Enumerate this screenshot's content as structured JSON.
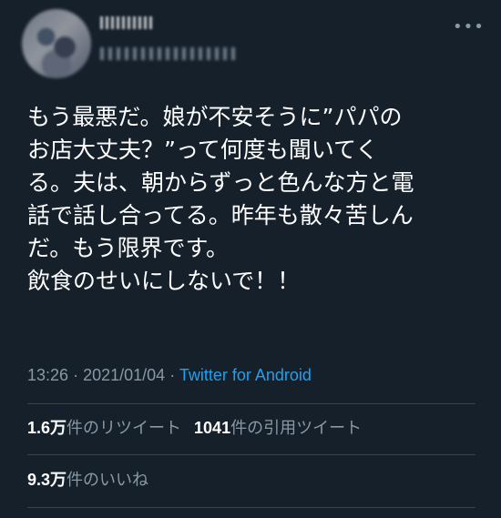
{
  "tweet": {
    "more_icon": "more-horizontal-icon",
    "body": "もう最悪だ。娘が不安そうに”パパの\nお店大丈夫？”って何度も聞いてく\nる。夫は、朝からずっと色んな方と電\n話で話し合ってる。昨年も散々苦しん\nだ。もう限界です。\n飲食のせいにしないで！！",
    "time": "13:26",
    "separator": "·",
    "date": "2021/01/04",
    "source": "Twitter for Android"
  },
  "stats": {
    "retweets_count": "1.6万",
    "retweets_label": "件のリツイート",
    "quotes_count": "1041",
    "quotes_label": "件の引用ツイート",
    "likes_count": "9.3万",
    "likes_label": "件のいいね"
  },
  "colors": {
    "background": "#15202b",
    "text": "#ffffff",
    "secondary": "#8899a6",
    "link": "#1da1f2",
    "divider": "#38444d"
  }
}
